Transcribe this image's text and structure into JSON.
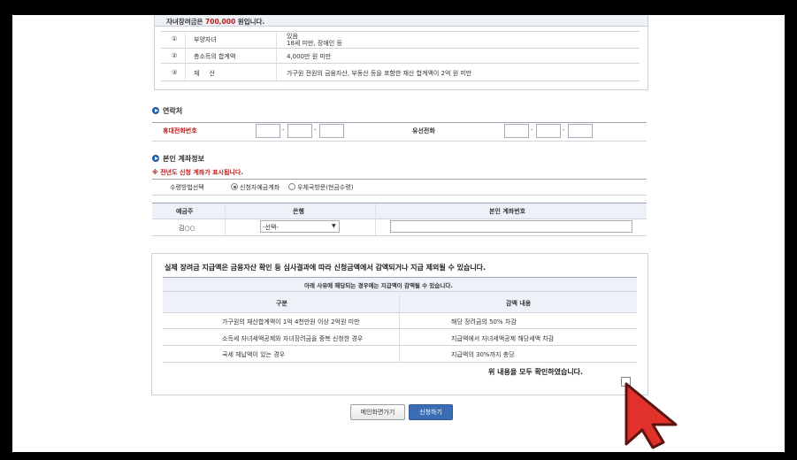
{
  "top_notice": {
    "prefix": "자녀장려금은 ",
    "amount": "700,000",
    "suffix": " 원입니다."
  },
  "criteria": [
    {
      "num": "①",
      "label": "부양자녀",
      "value_line1": "있음",
      "value_line2": "18세 미만, 장애인 등"
    },
    {
      "num": "②",
      "label": "총소득의 합계액",
      "value_line1": "4,000만 원 미만",
      "value_line2": ""
    },
    {
      "num": "③",
      "label": "재     산",
      "value_line1": "가구원 전원의 금융자산, 부동산 등을 포함한 재산 합계액이 2억 원 미만",
      "value_line2": ""
    }
  ],
  "contact": {
    "title": "연락처",
    "mobile_label": "휴대전화번호",
    "landline_label": "유선전화",
    "dash": "-"
  },
  "account": {
    "title": "본인 계좌정보",
    "notice": "※ 전년도 신청 계좌가 표시됩니다.",
    "method_label": "수령방법선택",
    "option_bank": "신청자예금계좌",
    "option_post": "우체국방문(현금수령)",
    "col_holder": "예금주",
    "col_bank": "은행",
    "col_number": "본인 계좌번호",
    "holder_value": "김○○",
    "bank_select": "-선택-"
  },
  "warning": {
    "headline": "실제 장려금 지급액은 금융자산 확인 등 심사결과에 따라 신청금액에서 감액되거나 지급 제외될 수 있습니다.",
    "sub": "아래 사유에 해당되는 경우에는 지급액이 감액될 수 있습니다.",
    "col_category": "구분",
    "col_detail": "감액 내용",
    "rows": [
      {
        "category": "가구원의 재산합계액이 1억 4천만원 이상 2억원 미만",
        "detail": "해당 장려금의 50% 차감"
      },
      {
        "category": "소득세 자녀세액공제와 자녀장려금을 중복 신청한 경우",
        "detail": "지급액에서 자녀세액공제 해당세액 차감"
      },
      {
        "category": "국세 체납액이 있는 경우",
        "detail": "지급액의 30%까지 충당"
      }
    ],
    "confirm": "위 내용을 모두 확인하였습니다."
  },
  "buttons": {
    "back": "메인화면가기",
    "apply": "신청하기"
  },
  "colors": {
    "accent_red": "#b71c1c",
    "button_blue": "#3a6db3",
    "section_icon": "#1f5fa8",
    "header_fill": "#eef1f8",
    "cursor_red": "#e0322a"
  }
}
